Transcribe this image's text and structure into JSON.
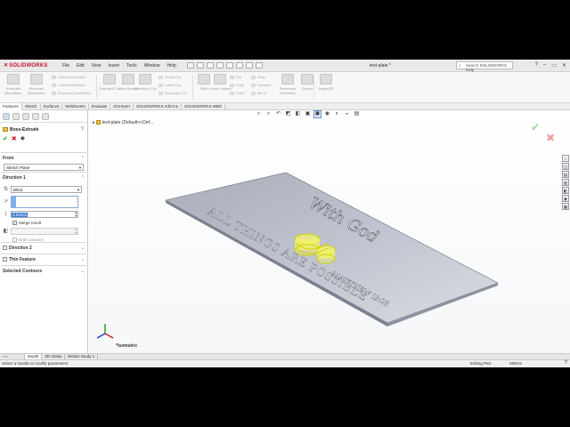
{
  "app": {
    "logo": "SOLIDWORKS",
    "menu": [
      "File",
      "Edit",
      "View",
      "Insert",
      "Tools",
      "Window",
      "Help"
    ],
    "document_title": "test-plate *",
    "search_placeholder": "Search SOLIDWORKS Help",
    "window_controls": [
      "?",
      "–",
      "▭",
      "✕"
    ]
  },
  "ribbon": {
    "big_buttons": [
      {
        "label": "Extruded Boss/Base",
        "icon": "extrude-icon"
      },
      {
        "label": "Revolved Boss/Base",
        "icon": "revolve-icon"
      },
      {
        "label": "Extruded Cut",
        "icon": "extruded-cut-icon"
      },
      {
        "label": "Hole Wizard",
        "icon": "hole-wizard-icon"
      },
      {
        "label": "Revolved Cut",
        "icon": "revolved-cut-icon"
      },
      {
        "label": "Fillet",
        "icon": "fillet-icon"
      },
      {
        "label": "Linear Pattern",
        "icon": "linear-pattern-icon"
      },
      {
        "label": "Reference Geometry",
        "icon": "reference-geometry-icon"
      },
      {
        "label": "Curves",
        "icon": "curves-icon"
      },
      {
        "label": "Instant3D",
        "icon": "instant3d-icon"
      }
    ],
    "small_group_1": [
      "Swept Boss/Base",
      "Lofted Boss/Base",
      "Boundary Boss/Base"
    ],
    "small_group_2": [
      "Swept Cut",
      "Lofted Cut",
      "Boundary Cut"
    ],
    "small_group_3": [
      "Rib",
      "Draft",
      "Shell"
    ],
    "small_group_4": [
      "Wrap",
      "Intersect",
      "Mirror"
    ]
  },
  "tabs": [
    {
      "label": "Features",
      "active": true
    },
    {
      "label": "Sketch",
      "active": false
    },
    {
      "label": "Surfaces",
      "active": false
    },
    {
      "label": "Weldments",
      "active": false
    },
    {
      "label": "Evaluate",
      "active": false
    },
    {
      "label": "DimXpert",
      "active": false
    },
    {
      "label": "SOLIDWORKS Add-Ins",
      "active": false
    },
    {
      "label": "SOLIDWORKS MBD",
      "active": false
    }
  ],
  "property_manager": {
    "title": "Boss-Extrude",
    "help": "?",
    "from": {
      "heading": "From",
      "value": "Sketch Plane"
    },
    "direction1": {
      "heading": "Direction 1",
      "end_condition": "Blind",
      "depth": "3.00mm",
      "merge_result": "Merge result",
      "draft_outward": "Draft outward"
    },
    "direction2": "Direction 2",
    "thin_feature": "Thin Feature",
    "selected_contours": "Selected Contours"
  },
  "viewport": {
    "tree_label": "test-plate  (Default<<Def...",
    "orientation": "*Isometric",
    "plate_text_line1": "ALL THINGS ARE POSSIBLE",
    "plate_text_line2": "MATTHEW 19:26",
    "plate_script": "With God"
  },
  "bottom_tabs": [
    {
      "label": "Model",
      "active": true
    },
    {
      "label": "3D Views",
      "active": false
    },
    {
      "label": "Motion Study 1",
      "active": false
    }
  ],
  "status": {
    "message": "Select a handle to modify parameters",
    "mode": "Editing Part",
    "units": "MMGS",
    "help": "?"
  },
  "colors": {
    "logo_red": "#c8102e",
    "plate": "#b9bdc8",
    "highlight_yellow": "#e6e600",
    "selection_blue": "#3b7ad6"
  }
}
